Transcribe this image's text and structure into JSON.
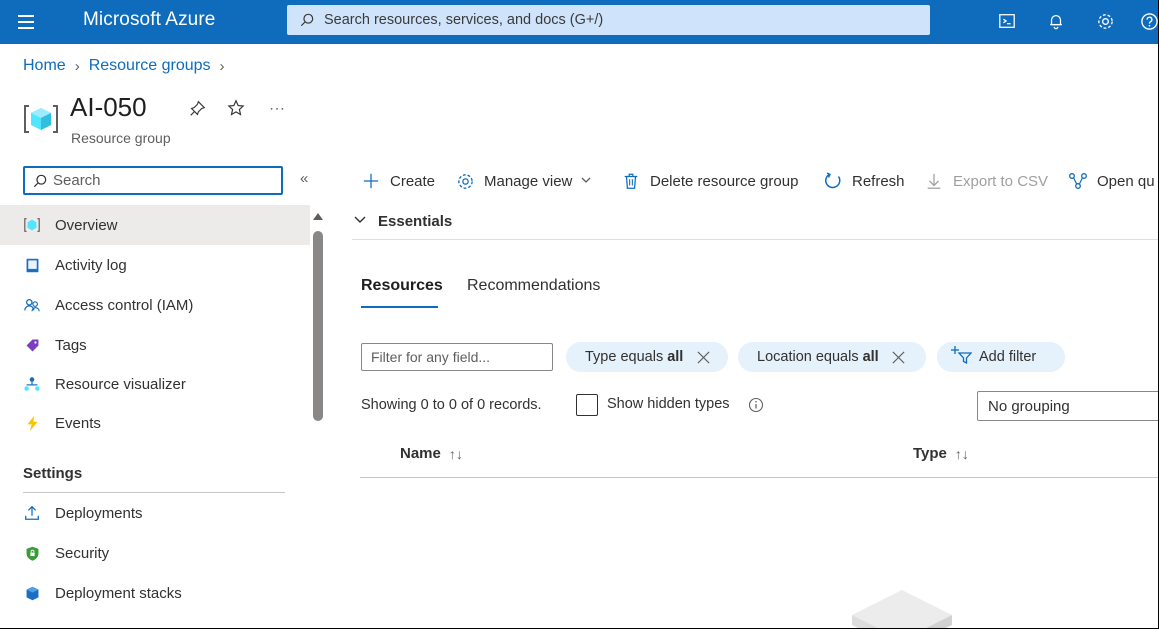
{
  "topbar": {
    "brand": "Microsoft Azure",
    "search_placeholder": "Search resources, services, and docs (G+/)",
    "icons": [
      "hamburger-menu-icon",
      "cloud-shell-icon",
      "bell-icon",
      "gear-icon",
      "help-icon"
    ]
  },
  "breadcrumb": {
    "items": [
      "Home",
      "Resource groups"
    ]
  },
  "header": {
    "title": "AI-050",
    "subtitle": "Resource group",
    "actions": [
      "pin-icon",
      "star-icon",
      "more-icon"
    ]
  },
  "sidebar": {
    "search_placeholder": "Search",
    "collapse_label": "«",
    "items": [
      {
        "label": "Overview",
        "icon": "resource-group-icon",
        "selected": true
      },
      {
        "label": "Activity log",
        "icon": "activity-log-icon"
      },
      {
        "label": "Access control (IAM)",
        "icon": "people-icon"
      },
      {
        "label": "Tags",
        "icon": "tag-icon"
      },
      {
        "label": "Resource visualizer",
        "icon": "visualizer-icon"
      },
      {
        "label": "Events",
        "icon": "lightning-icon"
      }
    ],
    "section_settings": "Settings",
    "settings_items": [
      {
        "label": "Deployments",
        "icon": "upload-icon"
      },
      {
        "label": "Security",
        "icon": "shield-icon"
      },
      {
        "label": "Deployment stacks",
        "icon": "stack-icon"
      }
    ]
  },
  "commands": {
    "create": "Create",
    "manage_view": "Manage view",
    "delete": "Delete resource group",
    "refresh": "Refresh",
    "export": "Export to CSV",
    "open_query": "Open qu"
  },
  "essentials": {
    "label": "Essentials"
  },
  "tabs": [
    {
      "label": "Resources",
      "active": true
    },
    {
      "label": "Recommendations",
      "active": false
    }
  ],
  "filters": {
    "field_placeholder": "Filter for any field...",
    "pills": [
      {
        "key": "Type equals",
        "value": "all"
      },
      {
        "key": "Location equals",
        "value": "all"
      }
    ],
    "add_filter": "Add filter"
  },
  "records": {
    "text": "Showing 0 to 0 of 0 records.",
    "show_hidden": "Show hidden types",
    "grouping": "No grouping"
  },
  "table": {
    "columns": [
      "Name",
      "Type"
    ],
    "sort_glyph": "↑↓",
    "rows": []
  },
  "colors": {
    "accent": "#0f6cbd",
    "search_bg": "#cfe4fa",
    "pill_bg": "#e5f1fb",
    "selected_bg": "#edebe9"
  }
}
